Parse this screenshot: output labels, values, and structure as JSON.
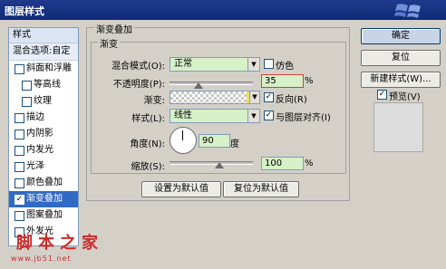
{
  "window": {
    "title": "图层样式"
  },
  "sidebar": {
    "header": "样式",
    "items": [
      {
        "label": "混合选项:自定",
        "type": "plain",
        "checked": false
      },
      {
        "label": "斜面和浮雕",
        "type": "check",
        "checked": false
      },
      {
        "label": "等高线",
        "type": "sub",
        "checked": false
      },
      {
        "label": "纹理",
        "type": "sub",
        "checked": false
      },
      {
        "label": "描边",
        "type": "check",
        "checked": false
      },
      {
        "label": "内阴影",
        "type": "check",
        "checked": false
      },
      {
        "label": "内发光",
        "type": "check",
        "checked": false
      },
      {
        "label": "光泽",
        "type": "check",
        "checked": false
      },
      {
        "label": "颜色叠加",
        "type": "check",
        "checked": false
      },
      {
        "label": "渐变叠加",
        "type": "check",
        "checked": true,
        "selected": true
      },
      {
        "label": "图案叠加",
        "type": "check",
        "checked": false
      },
      {
        "label": "外发光",
        "type": "check",
        "checked": false
      }
    ]
  },
  "panel": {
    "outer_title": "渐变叠加",
    "inner_title": "渐变",
    "blend_mode": {
      "label": "混合模式(O):",
      "value": "正常"
    },
    "dither": {
      "label": "仿色",
      "checked": false
    },
    "opacity": {
      "label": "不透明度(P):",
      "value": "35",
      "unit": "%",
      "level": 0.35
    },
    "gradient": {
      "label": "渐变:",
      "reverse_label": "反向(R)",
      "reverse_checked": true
    },
    "style": {
      "label": "样式(L):",
      "value": "线性"
    },
    "align": {
      "label": "与图层对齐(I)",
      "checked": true
    },
    "angle": {
      "label": "角度(N):",
      "value": "90",
      "unit": "度"
    },
    "scale": {
      "label": "缩放(S):",
      "value": "100",
      "unit": "%",
      "level": 0.6
    },
    "set_default": "设置为默认值",
    "reset_default": "复位为默认值"
  },
  "actions": {
    "ok": "确定",
    "reset": "复位",
    "new_style": "新建样式(W)...",
    "preview_label": "预览(V)",
    "preview_checked": true
  },
  "watermark": {
    "main": "脚本之家",
    "sub": "www.jb51.net"
  },
  "colors": {
    "title_bar": "#1f3a8c",
    "selection": "#316ac5",
    "field_green": "#d6f0c8",
    "watermark": "#cc2a2a"
  }
}
